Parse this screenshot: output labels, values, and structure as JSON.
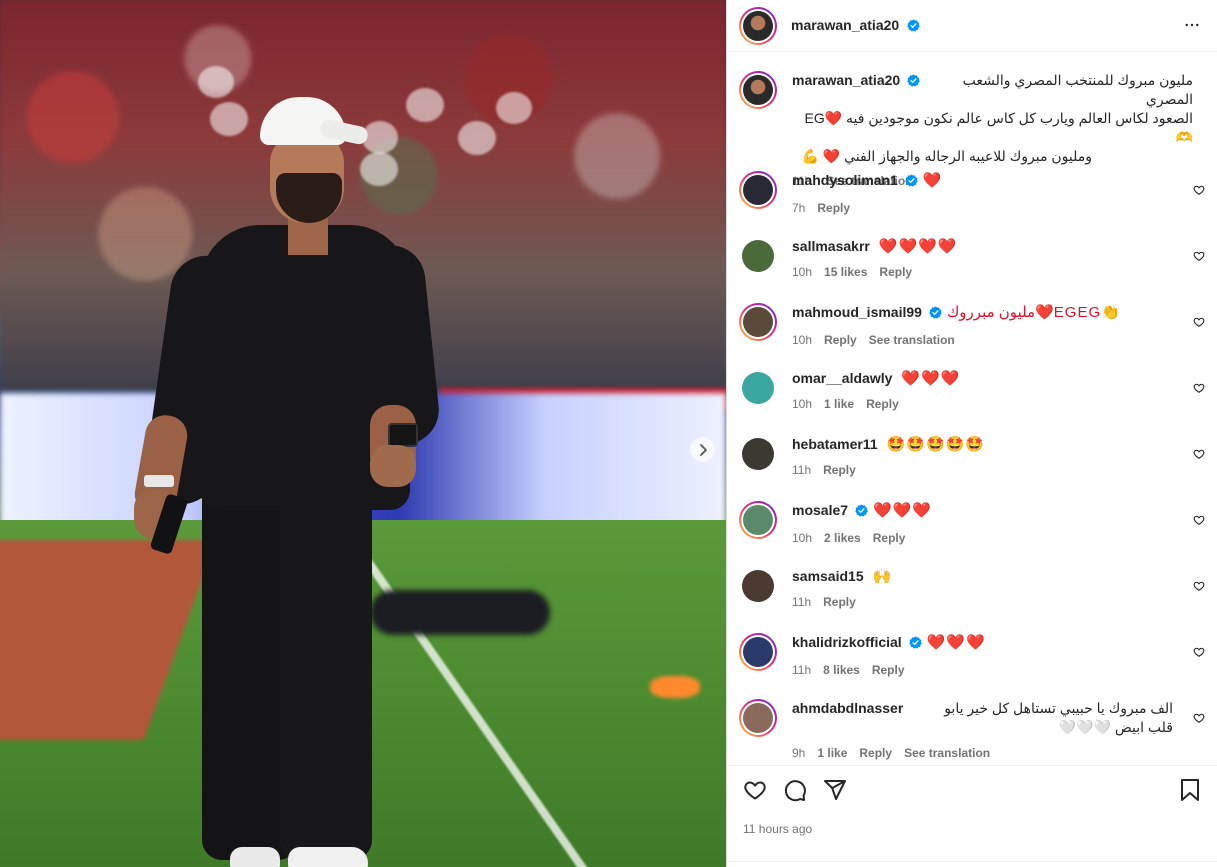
{
  "post": {
    "author": "marawan_atia20",
    "caption_line1": "مليون مبروك للمنتخب المصري والشعب المصري",
    "caption_line2": "الصعود لكاس العالم ويارب كل كاس عالم نكون موجودين فيه ❤️EG 🫶",
    "caption_line3": "ومليون مبروك للاعيبه الرجاله والجهاز الفني ❤️ 💪",
    "caption_time": "11h",
    "see_translation": "See translation",
    "time_ago": "11 hours ago"
  },
  "comments": [
    {
      "user": "mahdysoliman1",
      "verified": true,
      "text": "❤️",
      "time": "7h",
      "likes": "",
      "reply": "Reply",
      "translation": "",
      "avatar_color": "#2a2a36"
    },
    {
      "user": "sallmasakrr",
      "verified": false,
      "text": "❤️❤️❤️❤️",
      "time": "10h",
      "likes": "15 likes",
      "reply": "Reply",
      "translation": "",
      "avatar_color": "#4a6a3a"
    },
    {
      "user": "mahmoud_ismail99",
      "verified": true,
      "text": "مليون مبرروك❤️EGEG👏",
      "time": "10h",
      "likes": "",
      "reply": "Reply",
      "translation": "See translation",
      "avatar_color": "#5a4a3a"
    },
    {
      "user": "omar__aldawly",
      "verified": false,
      "text": "❤️❤️❤️",
      "time": "10h",
      "likes": "1 like",
      "reply": "Reply",
      "translation": "",
      "avatar_color": "#3aa8a0"
    },
    {
      "user": "hebatamer11",
      "verified": false,
      "text": "🤩🤩🤩🤩🤩",
      "time": "11h",
      "likes": "",
      "reply": "Reply",
      "translation": "",
      "avatar_color": "#3b3a32"
    },
    {
      "user": "mosale7",
      "verified": true,
      "text": "❤️❤️❤️",
      "time": "10h",
      "likes": "2 likes",
      "reply": "Reply",
      "translation": "",
      "avatar_color": "#5a8a6a"
    },
    {
      "user": "samsaid15",
      "verified": false,
      "text": "🙌",
      "time": "11h",
      "likes": "",
      "reply": "Reply",
      "translation": "",
      "avatar_color": "#4a3a32"
    },
    {
      "user": "khalidrizkofficial",
      "verified": true,
      "text": "❤️❤️❤️",
      "time": "11h",
      "likes": "8 likes",
      "reply": "Reply",
      "translation": "",
      "avatar_color": "#2a3a6a"
    },
    {
      "user": "ahmdabdlnasser",
      "verified": false,
      "text": "الف مبروك يا حبيبي تستاهل كل خير يابو قلب ابيض 🤍🤍🤍",
      "time": "9h",
      "likes": "1 like",
      "reply": "Reply",
      "translation": "See translation",
      "avatar_color": "#8a6a5a"
    }
  ],
  "icons": {
    "like": "heart-icon",
    "comment": "comment-icon",
    "share": "share-icon",
    "save": "bookmark-icon",
    "more": "more-icon",
    "verified": "verified-badge-icon",
    "next": "chevron-right-icon"
  },
  "colors": {
    "verified": "#0095f6",
    "heart": "#e0102c",
    "muted": "#737373"
  }
}
